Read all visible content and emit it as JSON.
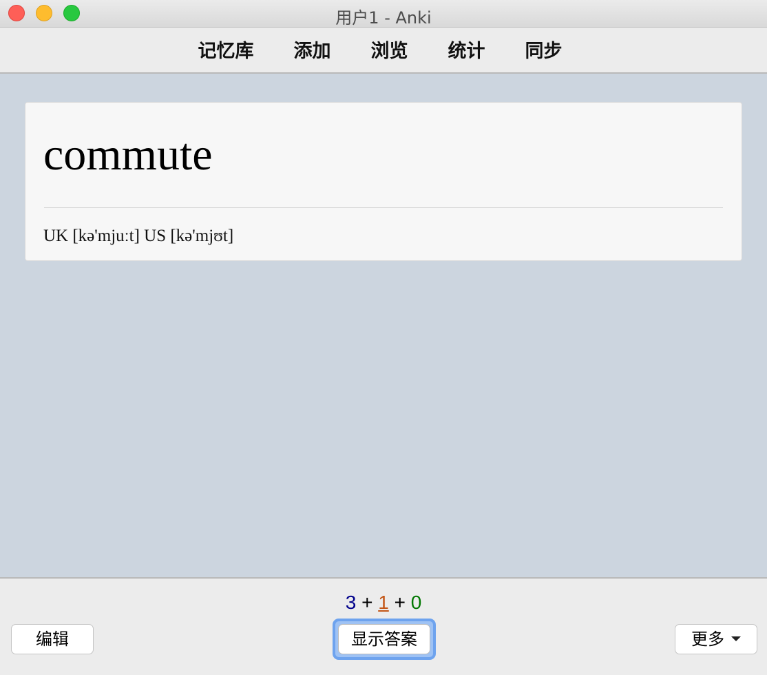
{
  "window": {
    "title": "用户1 - Anki"
  },
  "toolbar": {
    "items": [
      {
        "label": "记忆库"
      },
      {
        "label": "添加"
      },
      {
        "label": "浏览"
      },
      {
        "label": "统计"
      },
      {
        "label": "同步"
      }
    ]
  },
  "card": {
    "front": "commute",
    "pronunciation": "UK [kə'mjuːt] US [kə'mjʊt]"
  },
  "counts": {
    "new": "3",
    "learning": "1",
    "review": "0",
    "separator": "+"
  },
  "bottom": {
    "edit_label": "编辑",
    "show_answer_label": "显示答案",
    "more_label": "更多"
  },
  "colors": {
    "background": "#ccd5df",
    "new_count": "#00008b",
    "learning_count": "#c35617",
    "review_count": "#007700",
    "focus_ring": "#6ea3ee"
  }
}
